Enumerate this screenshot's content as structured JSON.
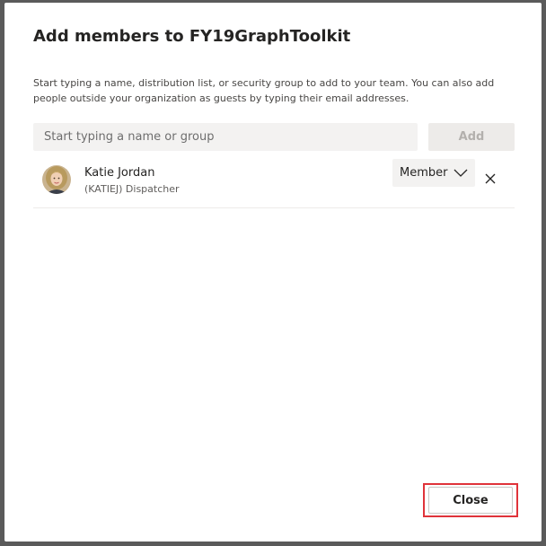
{
  "dialog": {
    "title": "Add members to FY19GraphToolkit",
    "description": "Start typing a name, distribution list, or security group to add to your team. You can also add people outside your organization as guests by typing their email addresses."
  },
  "search": {
    "placeholder": "Start typing a name or group",
    "value": ""
  },
  "add_button": {
    "label": "Add",
    "enabled": false
  },
  "members": [
    {
      "name": "Katie Jordan",
      "subtitle": "(KATIEJ) Dispatcher",
      "role": "Member",
      "avatar_icon": "user-photo"
    }
  ],
  "close_button": {
    "label": "Close"
  },
  "colors": {
    "highlight": "#e0333a",
    "input_background": "#f3f2f1",
    "disabled_text": "#b3b0ad"
  },
  "icons": {
    "role_dropdown": "chevron-down-icon",
    "remove_member": "close-icon"
  }
}
